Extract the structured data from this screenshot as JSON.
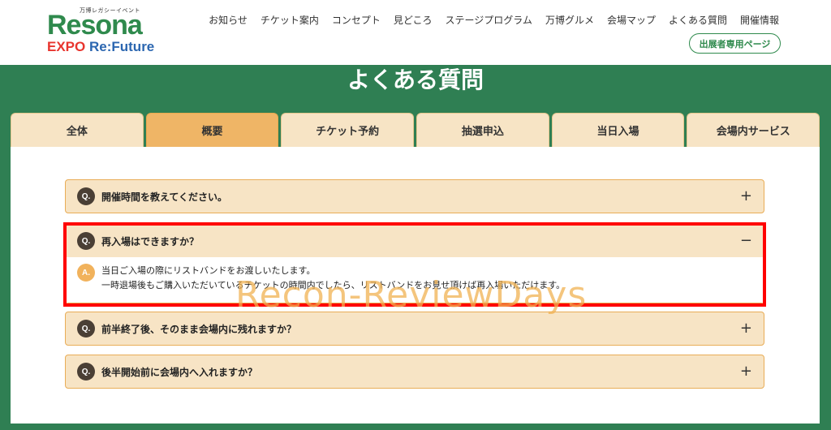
{
  "header": {
    "logo": {
      "tagline": "万博レガシーイベント",
      "brand": "Resona",
      "sub_expo": "EXPO",
      "sub_refuture": "Re:Future"
    },
    "nav": [
      "お知らせ",
      "チケット案内",
      "コンセプト",
      "見どころ",
      "ステージプログラム",
      "万博グルメ",
      "会場マップ",
      "よくある質問",
      "開催情報"
    ],
    "exhibitor_button": "出展者専用ページ"
  },
  "page_title": "よくある質問",
  "tabs": [
    {
      "label": "全体",
      "active": false
    },
    {
      "label": "概要",
      "active": true
    },
    {
      "label": "チケット予約",
      "active": false
    },
    {
      "label": "抽選申込",
      "active": false
    },
    {
      "label": "当日入場",
      "active": false
    },
    {
      "label": "会場内サービス",
      "active": false
    }
  ],
  "faq": [
    {
      "q_badge": "Q.",
      "question": "開催時間を教えてください。",
      "toggle": "+",
      "expanded": false
    },
    {
      "q_badge": "Q.",
      "question": "再入場はできますか？",
      "toggle": "−",
      "expanded": true,
      "a_badge": "A.",
      "answer": [
        "当日ご入場の際にリストバンドをお渡しいたします。",
        "一時退場後もご購入いただいているチケットの時間内でしたら、リストバンドをお見せ頂けば再入場いただけます。"
      ]
    },
    {
      "q_badge": "Q.",
      "question": "前半終了後、そのまま会場内に残れますか？",
      "toggle": "+",
      "expanded": false
    },
    {
      "q_badge": "Q.",
      "question": "後半開始前に会場内へ入れますか？",
      "toggle": "+",
      "expanded": false
    }
  ],
  "watermark": "Recon-ReviewDays",
  "colors": {
    "brand_green": "#2f8a4d",
    "band_green": "#2f7f53",
    "tab_bg": "#f7e4c5",
    "tab_active": "#efb566",
    "highlight": "#ff0000"
  }
}
